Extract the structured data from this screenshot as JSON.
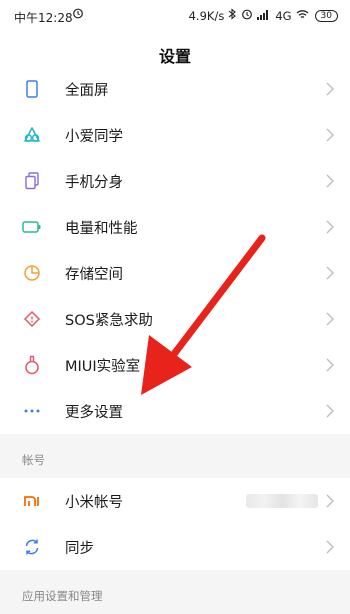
{
  "status_bar": {
    "time": "中午12:28",
    "alarm_icon": "alarm-icon",
    "speed": "4.9K/s",
    "network": "4G",
    "battery": "30"
  },
  "header": {
    "title": "设置"
  },
  "items": [
    {
      "label": "全面屏",
      "icon": "phone-frame-icon"
    },
    {
      "label": "小爱同学",
      "icon": "xiaoai-icon"
    },
    {
      "label": "手机分身",
      "icon": "second-space-icon"
    },
    {
      "label": "电量和性能",
      "icon": "battery-icon"
    },
    {
      "label": "存储空间",
      "icon": "storage-pie-icon"
    },
    {
      "label": "SOS紧急求助",
      "icon": "sos-icon"
    },
    {
      "label": "MIUI实验室",
      "icon": "lab-flask-icon"
    },
    {
      "label": "更多设置",
      "icon": "more-dots-icon"
    }
  ],
  "account_section": {
    "header": "帐号",
    "items": [
      {
        "label": "小米帐号",
        "icon": "mi-logo-icon"
      },
      {
        "label": "同步",
        "icon": "sync-icon"
      }
    ]
  },
  "apps_section": {
    "header": "应用设置和管理"
  },
  "colors": {
    "annotation_arrow": "#e8231b"
  }
}
